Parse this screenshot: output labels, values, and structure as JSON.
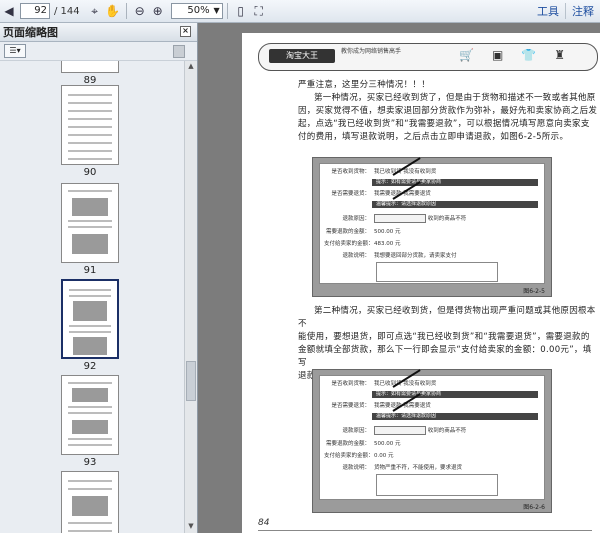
{
  "toolbar": {
    "current_page": "92",
    "total_pages": "/ 144",
    "zoom": "50%",
    "right_links": [
      "工具",
      "注释"
    ]
  },
  "sidebar": {
    "title": "页面缩略图",
    "thumbnails": [
      {
        "label": "89"
      },
      {
        "label": "90"
      },
      {
        "label": "91"
      },
      {
        "label": "92",
        "selected": true
      },
      {
        "label": "93"
      }
    ]
  },
  "page": {
    "header_logo": "淘宝大王",
    "header_sub": "教你成为网络销售高手",
    "page_number": "84",
    "para1": [
      "严重注意，这里分三种情况！！！",
      "第一种情况，买家已经收到货了，但是由于货物和描述不一致或者其他原",
      "因，买家觉得不值，想卖家退回部分货款作为弥补，最好先和卖家协商之后发",
      "起，点选“我已经收到货”和“我需要退款”，可以根据情况填写愿意向卖家支",
      "付的费用，填写退款说明，之后点击立即申请退款，如图6-2-5所示。"
    ],
    "para2": [
      "第二种情况，买家已经收到货，但是得货物出现严重问题或其他原因根本不",
      "能使用，要想退货，即可点选“我已经收到货”和“我需要退货”，需要退款的",
      "金额就填全部货款，那么下一行即会显示“支付给卖家的金额：0.00元”，填写",
      "退款说明，之后点击立即申请退款，如图6-2-6所示。"
    ],
    "fig1": {
      "caption": "图6-2-5",
      "rows": [
        {
          "label": "是否收到货物：",
          "value": "我已收到货  我没有收到货"
        },
        {
          "label": "是否需要退货：",
          "value": "我需要退款  我需要退货"
        },
        {
          "label": "退款原因：",
          "value": "收到的商品不符"
        },
        {
          "label": "需要退款的金额：",
          "value": "500.00  元"
        },
        {
          "label": "支付给卖家的金额：",
          "value": "483.00 元"
        },
        {
          "label": "退款说明：",
          "value": "我想要退回部分货款，请卖家支付"
        }
      ],
      "notes": [
        "提示：如有需要请与卖家协商",
        "温馨提示：请选择退款原因"
      ]
    },
    "fig2": {
      "caption": "图6-2-6",
      "rows": [
        {
          "label": "是否收到货物：",
          "value": "我已收到货  我没有收到货"
        },
        {
          "label": "是否需要退货：",
          "value": "我需要退款  我需要退货"
        },
        {
          "label": "退款原因：",
          "value": "收到的商品不符"
        },
        {
          "label": "需要退款的金额：",
          "value": "500.00  元"
        },
        {
          "label": "支付给卖家的金额：",
          "value": "0.00 元"
        },
        {
          "label": "退款说明：",
          "value": "货物严重不符，不能使用，要求退货"
        }
      ],
      "notes": [
        "提示：如有需要请与卖家协商",
        "温馨提示：请选择退款原因"
      ]
    }
  }
}
